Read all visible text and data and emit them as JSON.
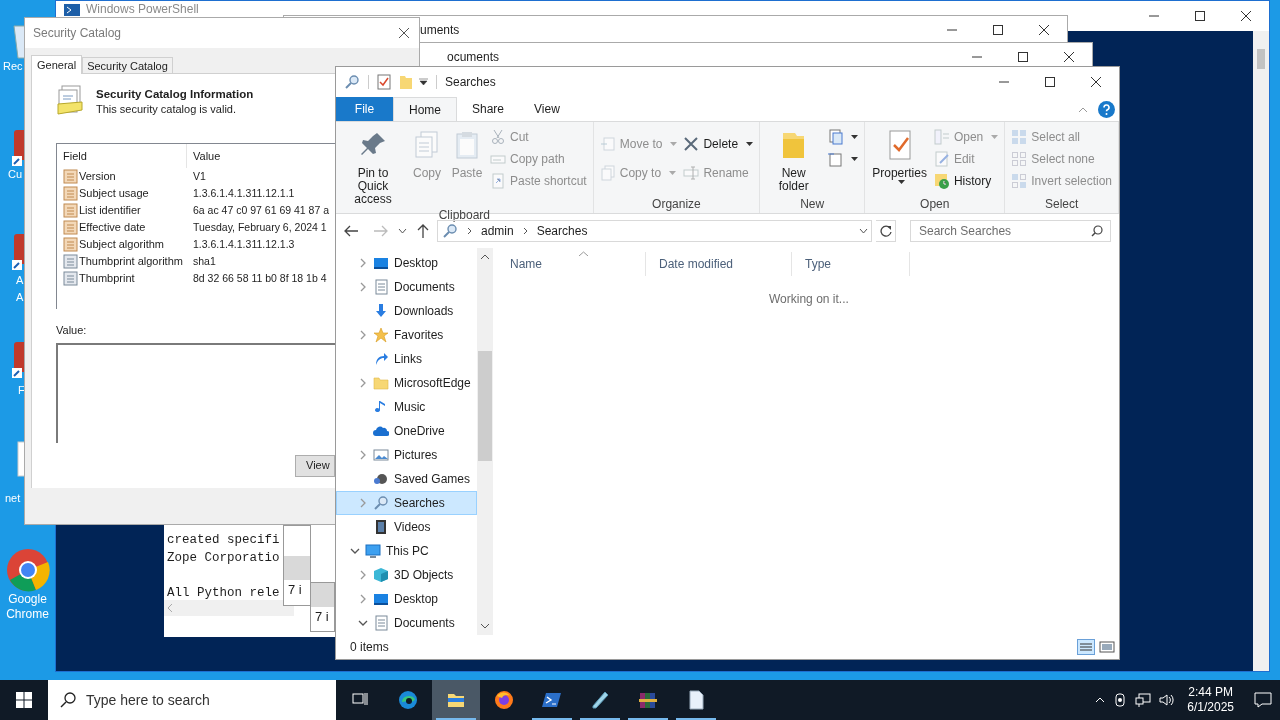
{
  "desktop_icons": [
    {
      "kind": "recycle",
      "lines": [
        "Rec"
      ]
    },
    {
      "kind": "shortcut",
      "lines": [
        "Cu"
      ]
    },
    {
      "kind": "shortcut",
      "lines": [
        "A",
        "A"
      ]
    },
    {
      "kind": "shortcut",
      "lines": [
        "F"
      ]
    },
    {
      "kind": "plain",
      "lines": [
        "net"
      ]
    },
    {
      "kind": "chrome",
      "lines": [
        "Google",
        "Chrome"
      ]
    }
  ],
  "powershell_window": {
    "title": "Windows PowerShell"
  },
  "text_window": {
    "lines": [
      "created specifi",
      "Zope Corporatio",
      "All Python rele"
    ],
    "side_panels": [
      "7 i",
      "7 i"
    ]
  },
  "background_windows": [
    {
      "title": "uments"
    },
    {
      "title": "ocuments"
    }
  ],
  "dialog": {
    "title": "Security Catalog",
    "tabs": [
      {
        "label": "General",
        "selected": true
      },
      {
        "label": "Security Catalog",
        "selected": false
      }
    ],
    "heading": "Security Catalog Information",
    "subheading": "This security catalog is valid.",
    "columns": [
      "Field",
      "Value"
    ],
    "rows": [
      {
        "kind": "attribute",
        "field": "Version",
        "value": "V1"
      },
      {
        "kind": "attribute",
        "field": "Subject usage",
        "value": "1.3.6.1.4.1.311.12.1.1"
      },
      {
        "kind": "attribute",
        "field": "List identifier",
        "value": "6a ac 47 c0 97 61 69 41 87 a"
      },
      {
        "kind": "attribute",
        "field": "Effective date",
        "value": "Tuesday, February 6, 2024 1"
      },
      {
        "kind": "attribute",
        "field": "Subject algorithm",
        "value": "1.3.6.1.4.1.311.12.1.3"
      },
      {
        "kind": "property",
        "field": "Thumbprint algorithm",
        "value": "sha1"
      },
      {
        "kind": "property",
        "field": "Thumbprint",
        "value": "8d 32 66 58 11 b0 8f 18 1b 4"
      }
    ],
    "value_label": "Value:",
    "button": "View"
  },
  "explorer": {
    "title": "Searches",
    "ribbon_tabs": [
      {
        "label": "File",
        "kind": "file",
        "selected": false
      },
      {
        "label": "Home",
        "kind": "tab",
        "selected": true
      },
      {
        "label": "Share",
        "kind": "tab",
        "selected": false
      },
      {
        "label": "View",
        "kind": "tab",
        "selected": false
      }
    ],
    "groups": [
      {
        "label": "Clipboard",
        "large": [
          {
            "label": "Pin to Quick access",
            "kind": "pin",
            "disabled": false,
            "dropdown": false
          },
          {
            "label": "Copy",
            "kind": "copy",
            "disabled": true,
            "dropdown": false
          },
          {
            "label": "Paste",
            "kind": "paste",
            "disabled": true,
            "dropdown": false
          }
        ],
        "small": [
          {
            "label": "Cut",
            "kind": "cut",
            "disabled": true,
            "dropdown": false
          },
          {
            "label": "Copy path",
            "kind": "path",
            "disabled": true,
            "dropdown": false
          },
          {
            "label": "Paste shortcut",
            "kind": "shortcut",
            "disabled": true,
            "dropdown": false
          }
        ]
      },
      {
        "label": "Organize",
        "small": [
          {
            "label": "Move to",
            "kind": "move",
            "disabled": true,
            "dropdown": true
          },
          {
            "label": "Copy to",
            "kind": "copyto",
            "disabled": true,
            "dropdown": true
          }
        ],
        "small2": [
          {
            "label": "Delete",
            "kind": "delete",
            "disabled": false,
            "dropdown": true
          },
          {
            "label": "Rename",
            "kind": "rename",
            "disabled": true,
            "dropdown": false
          }
        ]
      },
      {
        "label": "New",
        "large": [
          {
            "label": "New folder",
            "kind": "folder",
            "disabled": false,
            "dropdown": false
          }
        ],
        "small": [
          {
            "kind": "newitem",
            "disabled": false,
            "dropdown": true
          },
          {
            "kind": "easy",
            "disabled": false,
            "dropdown": true
          }
        ]
      },
      {
        "label": "Open",
        "large": [
          {
            "label": "Properties",
            "kind": "properties",
            "disabled": false,
            "dropdown": true
          }
        ],
        "small": [
          {
            "label": "Open",
            "kind": "open",
            "disabled": true,
            "dropdown": true
          },
          {
            "label": "Edit",
            "kind": "edit",
            "disabled": true,
            "dropdown": false
          },
          {
            "label": "History",
            "kind": "history",
            "disabled": false,
            "dropdown": false
          }
        ]
      },
      {
        "label": "Select",
        "small": [
          {
            "label": "Select all",
            "kind": "selall",
            "disabled": true,
            "dropdown": false
          },
          {
            "label": "Select none",
            "kind": "selnone",
            "disabled": true,
            "dropdown": false
          },
          {
            "label": "Invert selection",
            "kind": "invert",
            "disabled": true,
            "dropdown": false
          }
        ]
      }
    ],
    "path": [
      "admin",
      "Searches"
    ],
    "search_placeholder": "Search Searches",
    "tree": [
      {
        "children": [
          {
            "label": "Desktop",
            "kind": "desktop",
            "has_children": true,
            "expanded": false,
            "selected": false
          },
          {
            "label": "Documents",
            "kind": "documents",
            "has_children": true,
            "expanded": false,
            "selected": false
          },
          {
            "label": "Downloads",
            "kind": "downloads",
            "has_children": false,
            "selected": false
          },
          {
            "label": "Favorites",
            "kind": "star",
            "has_children": true,
            "expanded": false,
            "selected": false
          },
          {
            "label": "Links",
            "kind": "links",
            "has_children": false,
            "selected": false
          },
          {
            "label": "MicrosoftEdge",
            "kind": "folder",
            "has_children": true,
            "expanded": false,
            "selected": false
          },
          {
            "label": "Music",
            "kind": "music",
            "has_children": false,
            "selected": false
          },
          {
            "label": "OneDrive",
            "kind": "cloud",
            "has_children": false,
            "selected": false
          },
          {
            "label": "Pictures",
            "kind": "pictures",
            "has_children": true,
            "expanded": false,
            "selected": false
          },
          {
            "label": "Saved Games",
            "kind": "games",
            "has_children": false,
            "selected": false
          },
          {
            "label": "Searches",
            "kind": "search",
            "has_children": true,
            "expanded": false,
            "selected": true
          },
          {
            "label": "Videos",
            "kind": "videos",
            "has_children": false,
            "selected": false
          }
        ]
      },
      {
        "label": "This PC",
        "kind": "pc",
        "has_children": true,
        "expanded": true,
        "selected": false,
        "children": [
          {
            "label": "3D Objects",
            "kind": "cube",
            "has_children": true,
            "expanded": false,
            "selected": false
          },
          {
            "label": "Desktop",
            "kind": "desktop",
            "has_children": true,
            "expanded": false,
            "selected": false
          },
          {
            "label": "Documents",
            "kind": "documents",
            "has_children": true,
            "expanded": true,
            "selected": false
          }
        ]
      }
    ],
    "columns": [
      "Name",
      "Date modified",
      "Type"
    ],
    "message": "Working on it...",
    "status": "0 items"
  },
  "taskbar": {
    "search_placeholder": "Type here to search",
    "apps": [
      {
        "kind": "taskview",
        "active": false,
        "running": false
      },
      {
        "kind": "edge",
        "active": false,
        "running": false
      },
      {
        "kind": "explorer",
        "active": true,
        "running": true
      },
      {
        "kind": "firefox",
        "active": false,
        "running": false
      },
      {
        "kind": "powershell",
        "active": false,
        "running": true
      },
      {
        "kind": "app",
        "active": false,
        "running": true
      },
      {
        "kind": "winrar",
        "active": false,
        "running": true
      },
      {
        "kind": "notepad",
        "active": false,
        "running": true
      }
    ],
    "time": "2:44 PM",
    "date": "6/1/2025"
  }
}
